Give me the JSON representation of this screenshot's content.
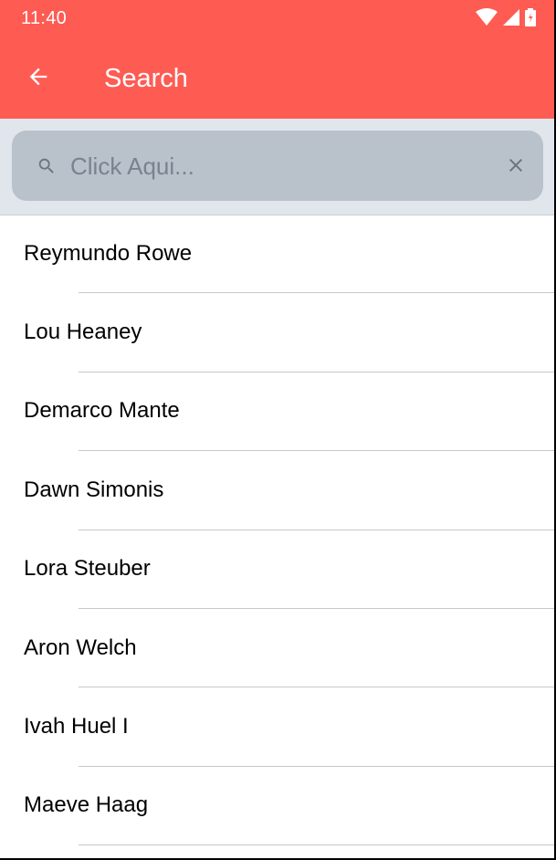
{
  "status_bar": {
    "time": "11:40",
    "icons": [
      "wifi-icon",
      "signal-icon",
      "battery-icon"
    ]
  },
  "toolbar": {
    "title": "Search",
    "back_icon": "arrow-back-icon"
  },
  "search": {
    "placeholder": "Click Aqui...",
    "value": "",
    "search_icon": "search-icon",
    "clear_icon": "close-icon"
  },
  "list": {
    "items": [
      {
        "label": "Reymundo Rowe"
      },
      {
        "label": "Lou Heaney"
      },
      {
        "label": "Demarco Mante"
      },
      {
        "label": "Dawn Simonis"
      },
      {
        "label": "Lora Steuber"
      },
      {
        "label": "Aron Welch"
      },
      {
        "label": "Ivah Huel I"
      },
      {
        "label": "Maeve Haag"
      }
    ]
  },
  "colors": {
    "header": "#fe5b53",
    "search_background": "#e1e6ec",
    "searchbar": "#b9c1cb",
    "divider": "#c8c7cc"
  }
}
